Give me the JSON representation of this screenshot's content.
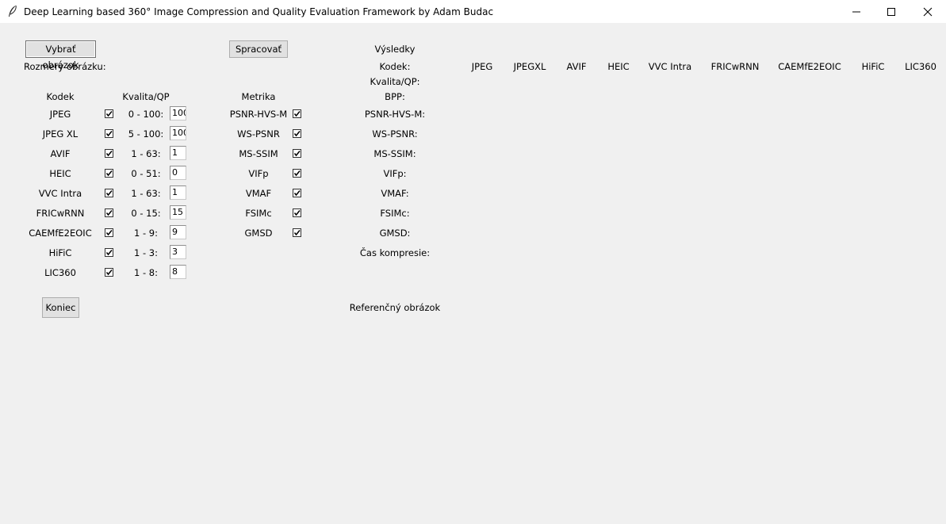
{
  "window": {
    "title": "Deep Learning based 360° Image Compression and Quality Evaluation Framework by Adam Budac",
    "icon": "feather-icon"
  },
  "buttons": {
    "select_image": "Vybrať obrázok",
    "process": "Spracovať",
    "quit": "Koniec"
  },
  "labels": {
    "image_size": "Rozmery obrázku:",
    "codec_header": "Kodek",
    "quality_header": "Kvalita/QP",
    "metric_header": "Metrika",
    "results_header": "Výsledky",
    "reference_image": "Referenčný obrázok"
  },
  "codecs": [
    {
      "name": "JPEG",
      "range": "0 - 100:",
      "value": "100",
      "checked": true
    },
    {
      "name": "JPEG XL",
      "range": "5 - 100:",
      "value": "100",
      "checked": true
    },
    {
      "name": "AVIF",
      "range": "1 - 63:",
      "value": "1",
      "checked": true
    },
    {
      "name": "HEIC",
      "range": "0 - 51:",
      "value": "0",
      "checked": true
    },
    {
      "name": "VVC Intra",
      "range": "1 - 63:",
      "value": "1",
      "checked": true
    },
    {
      "name": "FRICwRNN",
      "range": "0 - 15:",
      "value": "15",
      "checked": true
    },
    {
      "name": "CAEMfE2EOIC",
      "range": "1 - 9:",
      "value": "9",
      "checked": true
    },
    {
      "name": "HiFiC",
      "range": "1 - 3:",
      "value": "3",
      "checked": true
    },
    {
      "name": "LIC360",
      "range": "1 - 8:",
      "value": "8",
      "checked": true
    }
  ],
  "metrics": [
    {
      "name": "PSNR-HVS-M",
      "checked": true
    },
    {
      "name": "WS-PSNR",
      "checked": true
    },
    {
      "name": "MS-SSIM",
      "checked": true
    },
    {
      "name": "VIFp",
      "checked": true
    },
    {
      "name": "VMAF",
      "checked": true
    },
    {
      "name": "FSIMc",
      "checked": true
    },
    {
      "name": "GMSD",
      "checked": true
    }
  ],
  "results": {
    "row_labels": [
      "Kodek:",
      "Kvalita/QP:",
      "BPP:",
      "PSNR-HVS-M:",
      "WS-PSNR:",
      "MS-SSIM:",
      "VIFp:",
      "VMAF:",
      "FSIMc:",
      "GMSD:",
      "Čas kompresie:"
    ],
    "codec_columns": [
      "JPEG",
      "JPEGXL",
      "AVIF",
      "HEIC",
      "VVC Intra",
      "FRICwRNN",
      "CAEMfE2EOIC",
      "HiFiC",
      "LIC360"
    ]
  }
}
